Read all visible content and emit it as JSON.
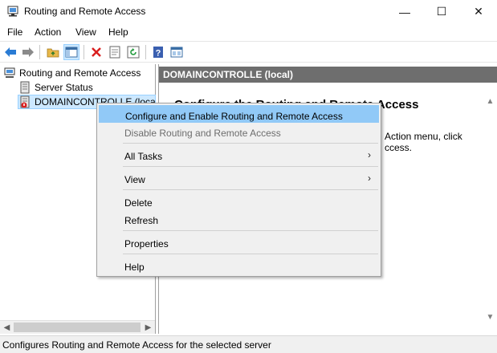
{
  "window": {
    "title": "Routing and Remote Access",
    "minimize": "—",
    "maximize": "☐",
    "close": "✕"
  },
  "menubar": [
    "File",
    "Action",
    "View",
    "Help"
  ],
  "toolbar": {
    "icons": [
      "back-icon",
      "forward-icon",
      "up-folder-icon",
      "show-hide-tree-icon",
      "delete-icon",
      "properties-icon",
      "refresh-icon",
      "help-icon",
      "console-icon"
    ]
  },
  "tree": {
    "root": "Routing and Remote Access",
    "items": [
      {
        "label": "Server Status",
        "icon": "server-status-icon"
      },
      {
        "label": "DOMAINCONTROLLE (local)",
        "icon": "server-down-icon"
      }
    ]
  },
  "right_pane": {
    "header": "DOMAINCONTROLLE (local)",
    "content_title": "Configure the Routing and Remote Access",
    "content_text": "Action menu, click ccess."
  },
  "context_menu": {
    "items": [
      {
        "label": "Configure and Enable Routing and Remote Access",
        "state": "highlighted"
      },
      {
        "label": "Disable Routing and Remote Access",
        "state": "disabled"
      },
      {
        "label": "All Tasks",
        "state": "normal",
        "submenu": "›"
      },
      {
        "label": "View",
        "state": "normal",
        "submenu": "›"
      },
      {
        "label": "Delete",
        "state": "normal"
      },
      {
        "label": "Refresh",
        "state": "normal"
      },
      {
        "label": "Properties",
        "state": "normal"
      },
      {
        "label": "Help",
        "state": "normal"
      }
    ]
  },
  "status_bar": "Configures Routing and Remote Access for the selected server",
  "colors": {
    "highlight": "#91c9f7",
    "tree_selection": "#cce8ff",
    "header_bg": "#6e6e6e",
    "menu_bg": "#f0f0f0"
  }
}
